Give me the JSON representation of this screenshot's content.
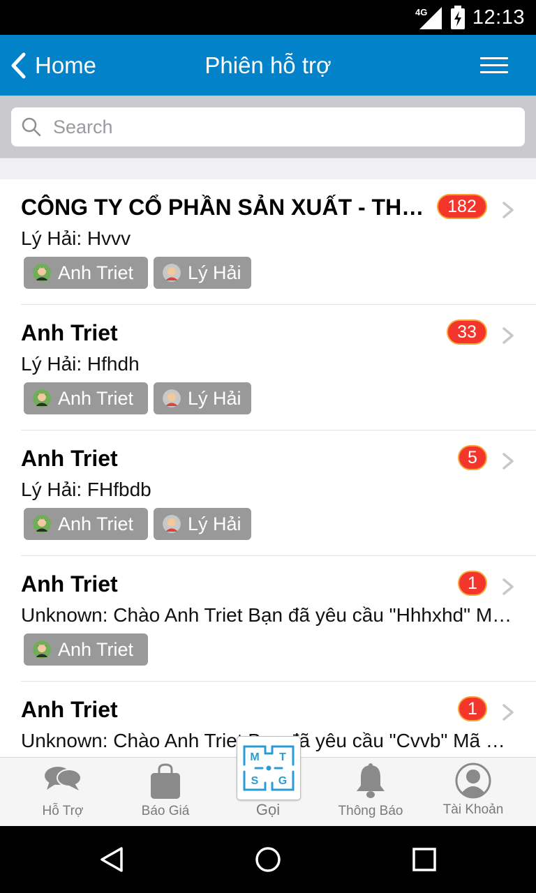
{
  "status_bar": {
    "network": "4G",
    "time": "12:13"
  },
  "header": {
    "back_label": "Home",
    "title": "Phiên hỗ trợ",
    "accent": "#0282c8"
  },
  "search": {
    "placeholder": "Search",
    "value": ""
  },
  "sessions": [
    {
      "title": "CÔNG TY CỔ PHẦN SẢN XUẤT - THƯƠNG MẠI",
      "badge": "182",
      "subtitle": "Lý Hải: Hvvv",
      "participants": [
        "Anh Triet",
        "Lý Hải"
      ]
    },
    {
      "title": "Anh Triet",
      "badge": "33",
      "subtitle": "Lý Hải: Hfhdh",
      "participants": [
        "Anh Triet",
        "Lý Hải"
      ]
    },
    {
      "title": "Anh Triet",
      "badge": "5",
      "subtitle": "Lý Hải: FHfbdb",
      "participants": [
        "Anh Triet",
        "Lý Hải"
      ]
    },
    {
      "title": "Anh Triet",
      "badge": "1",
      "subtitle": "Unknown: Chào Anh Triet Bạn đã yêu cầu \"Hhhxhd\" Mã phiên hỗ trợ",
      "participants": [
        "Anh Triet"
      ]
    },
    {
      "title": "Anh Triet",
      "badge": "1",
      "subtitle": "Unknown: Chào Anh Triet Bạn đã yêu cầu \"Cvvb\" Mã phiên hỗ trợ",
      "participants": []
    }
  ],
  "tabbar": {
    "items": [
      {
        "label": "Hỗ Trợ",
        "icon": "chat-bubbles-icon"
      },
      {
        "label": "Báo Giá",
        "icon": "shopping-bag-icon"
      },
      {
        "label": "Gọi",
        "icon": "mtsg-logo"
      },
      {
        "label": "Thông Báo",
        "icon": "bell-icon"
      },
      {
        "label": "Tài Khoản",
        "icon": "account-icon"
      }
    ],
    "logo_letters": [
      "M",
      "T",
      "S",
      "G"
    ]
  },
  "colors": {
    "badge": "#f3352c",
    "badge_border": "#f7a436",
    "tag_bg": "#999999",
    "logo": "#2a9bd6"
  }
}
